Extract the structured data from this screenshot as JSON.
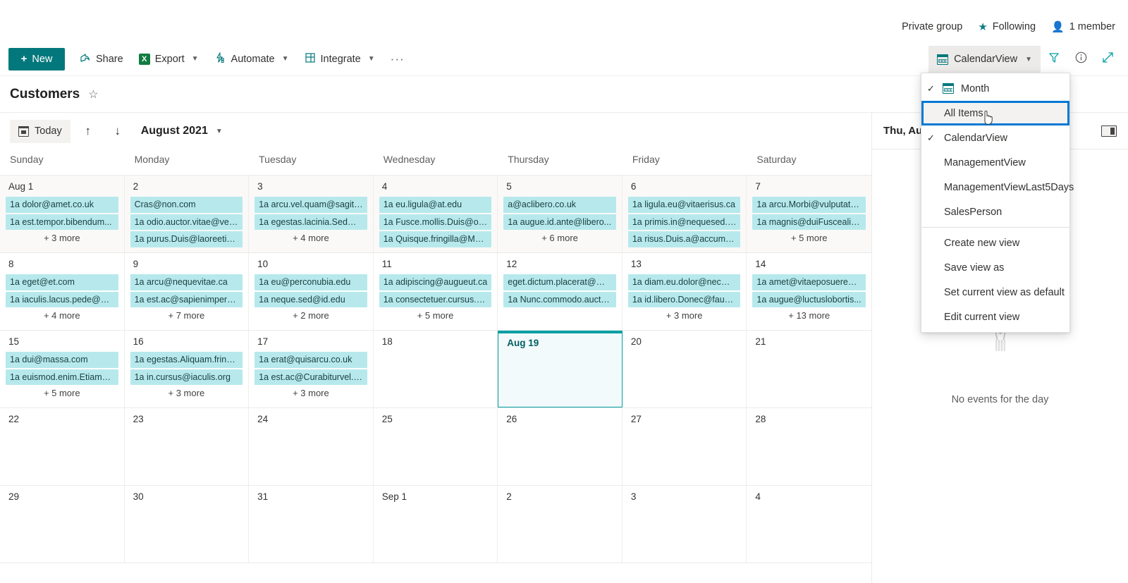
{
  "site": {
    "privacy_label": "Private group",
    "following_label": "Following",
    "members_label": "1 member"
  },
  "toolbar": {
    "new_label": "New",
    "share_label": "Share",
    "export_label": "Export",
    "automate_label": "Automate",
    "integrate_label": "Integrate",
    "overflow_label": "···",
    "view_picker_label": "CalendarView"
  },
  "page": {
    "title": "Customers"
  },
  "calendar_toolbar": {
    "today_label": "Today",
    "prev_label": "↑",
    "next_label": "↓",
    "month_label": "August 2021"
  },
  "weekdays": [
    "Sunday",
    "Monday",
    "Tuesday",
    "Wednesday",
    "Thursday",
    "Friday",
    "Saturday"
  ],
  "view_menu": {
    "items": [
      {
        "label": "Month",
        "checked": true,
        "icon": "calendar-icon"
      },
      {
        "label": "All Items",
        "checked": false,
        "focused": true
      },
      {
        "label": "CalendarView",
        "checked": true
      },
      {
        "label": "ManagementView",
        "checked": false
      },
      {
        "label": "ManagementViewLast5Days",
        "checked": false
      },
      {
        "label": "SalesPerson",
        "checked": false
      },
      {
        "label": "Create new view",
        "checked": false,
        "separator_before": true
      },
      {
        "label": "Save view as",
        "checked": false
      },
      {
        "label": "Set current view as default",
        "checked": false
      },
      {
        "label": "Edit current view",
        "checked": false
      }
    ]
  },
  "detail_panel": {
    "date_label": "Thu, Au",
    "empty_text": "No events for the day"
  },
  "chart_data": {
    "type": "table",
    "title": "August 2021",
    "weeks": [
      [
        {
          "daynum": "Aug 1",
          "shaded": true,
          "selected": false,
          "events": [
            "1a dolor@amet.co.uk",
            "1a est.tempor.bibendum..."
          ],
          "more": "+ 3 more"
        },
        {
          "daynum": "2",
          "shaded": true,
          "selected": false,
          "events": [
            "Cras@non.com",
            "1a odio.auctor.vitae@vel....",
            "1a purus.Duis@laoreetips..."
          ],
          "more": ""
        },
        {
          "daynum": "3",
          "shaded": true,
          "selected": false,
          "events": [
            "1a arcu.vel.quam@sagitti...",
            "1a egestas.lacinia.Sed@ve..."
          ],
          "more": "+ 4 more"
        },
        {
          "daynum": "4",
          "shaded": true,
          "selected": false,
          "events": [
            "1a eu.ligula@at.edu",
            "1a Fusce.mollis.Duis@orci...",
            "1a Quisque.fringilla@Mor..."
          ],
          "more": ""
        },
        {
          "daynum": "5",
          "shaded": true,
          "selected": false,
          "events": [
            "a@aclibero.co.uk",
            "1a augue.id.ante@libero..."
          ],
          "more": "+ 6 more"
        },
        {
          "daynum": "6",
          "shaded": true,
          "selected": false,
          "events": [
            "1a ligula.eu@vitaerisus.ca",
            "1a primis.in@nequesed.org",
            "1a risus.Duis.a@accumsa..."
          ],
          "more": ""
        },
        {
          "daynum": "7",
          "shaded": true,
          "selected": false,
          "events": [
            "1a arcu.Morbi@vulputate...",
            "1a magnis@duiFuscealiqu..."
          ],
          "more": "+ 5 more"
        }
      ],
      [
        {
          "daynum": "8",
          "shaded": false,
          "selected": false,
          "events": [
            "1a eget@et.com",
            "1a iaculis.lacus.pede@ultr..."
          ],
          "more": "+ 4 more"
        },
        {
          "daynum": "9",
          "shaded": false,
          "selected": false,
          "events": [
            "1a arcu@nequevitae.ca",
            "1a est.ac@sapienimperdi..."
          ],
          "more": "+ 7 more"
        },
        {
          "daynum": "10",
          "shaded": false,
          "selected": false,
          "events": [
            "1a eu@perconubia.edu",
            "1a neque.sed@id.edu"
          ],
          "more": "+ 2 more"
        },
        {
          "daynum": "11",
          "shaded": false,
          "selected": false,
          "events": [
            "1a adipiscing@augueut.ca",
            "1a consectetuer.cursus.et..."
          ],
          "more": "+ 5 more"
        },
        {
          "daynum": "12",
          "shaded": false,
          "selected": false,
          "events": [
            "eget.dictum.placerat@ma...",
            "1a Nunc.commodo.auctor..."
          ],
          "more": ""
        },
        {
          "daynum": "13",
          "shaded": false,
          "selected": false,
          "events": [
            "1a diam.eu.dolor@necme...",
            "1a id.libero.Donec@fauci..."
          ],
          "more": "+ 3 more"
        },
        {
          "daynum": "14",
          "shaded": false,
          "selected": false,
          "events": [
            "1a amet@vitaeposuereat....",
            "1a augue@luctuslobortis..."
          ],
          "more": "+ 13 more"
        }
      ],
      [
        {
          "daynum": "15",
          "shaded": false,
          "selected": false,
          "events": [
            "1a dui@massa.com",
            "1a euismod.enim.Etiam@..."
          ],
          "more": "+ 5 more"
        },
        {
          "daynum": "16",
          "shaded": false,
          "selected": false,
          "events": [
            "1a egestas.Aliquam.fringil...",
            "1a in.cursus@iaculis.org"
          ],
          "more": "+ 3 more"
        },
        {
          "daynum": "17",
          "shaded": false,
          "selected": false,
          "events": [
            "1a erat@quisarcu.co.uk",
            "1a est.ac@Curabiturvel.co..."
          ],
          "more": "+ 3 more"
        },
        {
          "daynum": "18",
          "shaded": false,
          "selected": false,
          "events": [],
          "more": ""
        },
        {
          "daynum": "Aug 19",
          "shaded": false,
          "selected": true,
          "events": [],
          "more": ""
        },
        {
          "daynum": "20",
          "shaded": false,
          "selected": false,
          "events": [],
          "more": ""
        },
        {
          "daynum": "21",
          "shaded": false,
          "selected": false,
          "events": [],
          "more": ""
        }
      ],
      [
        {
          "daynum": "22",
          "shaded": false,
          "selected": false,
          "events": [],
          "more": ""
        },
        {
          "daynum": "23",
          "shaded": false,
          "selected": false,
          "events": [],
          "more": ""
        },
        {
          "daynum": "24",
          "shaded": false,
          "selected": false,
          "events": [],
          "more": ""
        },
        {
          "daynum": "25",
          "shaded": false,
          "selected": false,
          "events": [],
          "more": ""
        },
        {
          "daynum": "26",
          "shaded": false,
          "selected": false,
          "events": [],
          "more": ""
        },
        {
          "daynum": "27",
          "shaded": false,
          "selected": false,
          "events": [],
          "more": ""
        },
        {
          "daynum": "28",
          "shaded": false,
          "selected": false,
          "events": [],
          "more": ""
        }
      ],
      [
        {
          "daynum": "29",
          "shaded": false,
          "selected": false,
          "events": [],
          "more": ""
        },
        {
          "daynum": "30",
          "shaded": false,
          "selected": false,
          "events": [],
          "more": ""
        },
        {
          "daynum": "31",
          "shaded": false,
          "selected": false,
          "events": [],
          "more": ""
        },
        {
          "daynum": "Sep 1",
          "shaded": false,
          "selected": false,
          "events": [],
          "more": ""
        },
        {
          "daynum": "2",
          "shaded": false,
          "selected": false,
          "events": [],
          "more": ""
        },
        {
          "daynum": "3",
          "shaded": false,
          "selected": false,
          "events": [],
          "more": ""
        },
        {
          "daynum": "4",
          "shaded": false,
          "selected": false,
          "events": [],
          "more": ""
        }
      ]
    ]
  },
  "colors": {
    "accent": "#03787c",
    "event_chip": "#b7e9ec",
    "selection": "#03a0a4",
    "focus_ring": "#0078d4"
  }
}
